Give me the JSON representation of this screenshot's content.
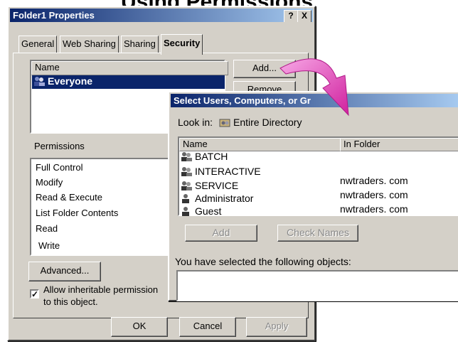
{
  "slide": {
    "title": "Using Permissions"
  },
  "props": {
    "title": "Folder1 Properties",
    "help_btn": "?",
    "close_btn": "X",
    "tabs": [
      "General",
      "Web Sharing",
      "Sharing",
      "Security"
    ],
    "name_header": "Name",
    "names": [
      "Everyone"
    ],
    "add_label": "Add...",
    "remove_label": "Remove",
    "permissions_label": "Permissions",
    "perms": [
      "Full Control",
      "Modify",
      "Read & Execute",
      "List Folder Contents",
      "Read",
      "Write"
    ],
    "advanced_label": "Advanced...",
    "inherit_line1": "Allow inheritable permission",
    "inherit_line2": "to this object.",
    "ok_label": "OK",
    "cancel_label": "Cancel",
    "apply_label": "Apply"
  },
  "select": {
    "title": "Select Users, Computers, or Gr",
    "lookin_label": "Look in:",
    "lookin_value": "Entire Directory",
    "col_name": "Name",
    "col_folder": "In Folder",
    "rows": [
      {
        "name": "BATCH",
        "folder": ""
      },
      {
        "name": "INTERACTIVE",
        "folder": ""
      },
      {
        "name": "SERVICE",
        "folder": "nwtraders. com"
      },
      {
        "name": "Administrator",
        "folder": "nwtraders. com"
      },
      {
        "name": "Guest",
        "folder": "nwtraders. com"
      }
    ],
    "add_label": "Add",
    "check_names_label": "Check Names",
    "selected_label": "You have selected the following objects:"
  },
  "colors": {
    "titlebar": "#0a246a",
    "face": "#d4d0c8",
    "arrow": "#e040c0"
  }
}
